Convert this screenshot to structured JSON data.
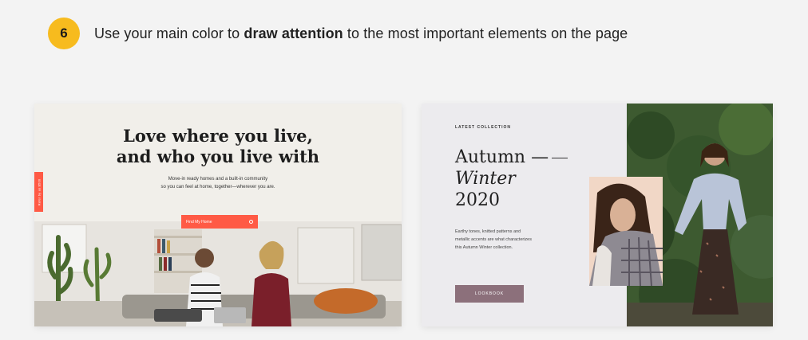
{
  "tip": {
    "number": "6",
    "text_before": "Use your main color to ",
    "text_bold": "draw attention",
    "text_after": " to the most important elements on the page"
  },
  "card_home": {
    "headline_line1": "Love where you live,",
    "headline_line2": "and who you live with",
    "sub_line1": "Move-in ready homes and a built-in community",
    "sub_line2": "so you can feel at home, together—wherever you are.",
    "side_tab_label": "Refer by us $500",
    "cta_label": "Find My Home",
    "accent_color": "#ff5a45"
  },
  "card_fashion": {
    "eyebrow": "LATEST COLLECTION",
    "title_line1": "Autumn —",
    "title_line2": "Winter",
    "title_line3": "2020",
    "body": "Earthy tones, knitted patterns and metallic accents are what characterizes this Autumn Winter collection.",
    "button_label": "LOOKBOOK",
    "accent_color": "#8c707b"
  }
}
